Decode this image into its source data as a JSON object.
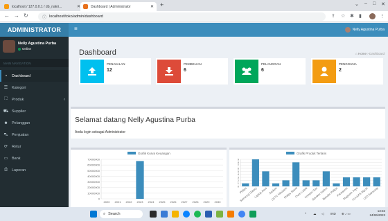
{
  "browser": {
    "tabs": [
      {
        "title": "localhost / 127.0.0.1 / db_nakri...",
        "active": false
      },
      {
        "title": "Dashboard | Administrator",
        "active": true
      }
    ],
    "url": "localhost/toko/admin/dashboard"
  },
  "app": {
    "brand": "ADMINISTRATOR",
    "header_user": "Nelly Agustina Purba"
  },
  "sidebar": {
    "user_name": "Nelly Agustina Purba",
    "status": "Online",
    "section": "MAIN NAVIGATION",
    "items": [
      {
        "label": "Dashboard",
        "icon": "dashboard-icon",
        "active": true
      },
      {
        "label": "Kategori",
        "icon": "list-icon"
      },
      {
        "label": "Produk",
        "icon": "cubes-icon",
        "chevron": "‹"
      },
      {
        "label": "Supplier",
        "icon": "truck-icon"
      },
      {
        "label": "Pelanggan",
        "icon": "users-icon"
      },
      {
        "label": "Penjualan",
        "icon": "cart-icon"
      },
      {
        "label": "Retur",
        "icon": "refresh-icon"
      },
      {
        "label": "Bank",
        "icon": "bank-icon"
      },
      {
        "label": "Laporan",
        "icon": "print-icon"
      }
    ]
  },
  "page": {
    "title": "Dashboard",
    "breadcrumb": {
      "home": "Home",
      "current": "Dashboard"
    }
  },
  "info_boxes": [
    {
      "label": "PENJUALAN",
      "value": "12",
      "color": "#00c0ef",
      "icon": "upload-icon"
    },
    {
      "label": "PEMBELIAN",
      "value": "6",
      "color": "#dd4b39",
      "icon": "download-icon"
    },
    {
      "label": "PELANGGAN",
      "value": "6",
      "color": "#00a65a",
      "icon": "users-icon"
    },
    {
      "label": "PENGGUNA",
      "value": "2",
      "color": "#f39c12",
      "icon": "user-icon"
    }
  ],
  "welcome": {
    "title": "Selamat datang Nelly Agustina Purba",
    "subtitle": "Anda login sebagai Administrator"
  },
  "chart_data": [
    {
      "type": "bar",
      "legend": "Grafik Kurva Keuangan",
      "categories": [
        "2020",
        "2021",
        "2022",
        "2023",
        "2024",
        "2025",
        "2026",
        "2027",
        "2028",
        "2029",
        "2030"
      ],
      "values": [
        0,
        0,
        0,
        67000000,
        0,
        0,
        0,
        0,
        0,
        0,
        0
      ],
      "ylim": [
        0,
        70000000
      ],
      "yticks": [
        "70000000",
        "60000000",
        "50000000",
        "40000000",
        "30000000",
        "20000000",
        "10000000",
        "0"
      ],
      "color": "#3c8dbc"
    },
    {
      "type": "bar",
      "legend": "Grafik Produk Terlaris",
      "categories": [
        "Philips",
        "Samsung Galaxy",
        "Laptop Asus",
        "Sanken",
        "CCTV Hikvision",
        "Philips Stand",
        "Oven Listrik",
        "Kompor Gas",
        "Speaker Earfun",
        "Blender Philips",
        "Panasonic",
        "Magicom Yoyo",
        "KULKAS AQUA",
        "LED Samsung"
      ],
      "values": [
        1,
        9,
        5,
        1,
        2,
        8,
        2,
        2,
        5,
        1,
        3,
        3,
        3,
        3
      ],
      "ylim": [
        0,
        9
      ],
      "yticks": [
        "9",
        "8",
        "7",
        "6",
        "5",
        "4",
        "3",
        "2",
        "1",
        "0"
      ],
      "color": "#3c8dbc"
    }
  ],
  "taskbar": {
    "search": "Search",
    "lang": "IND",
    "time": "13:32",
    "date": "24/06/2023"
  }
}
